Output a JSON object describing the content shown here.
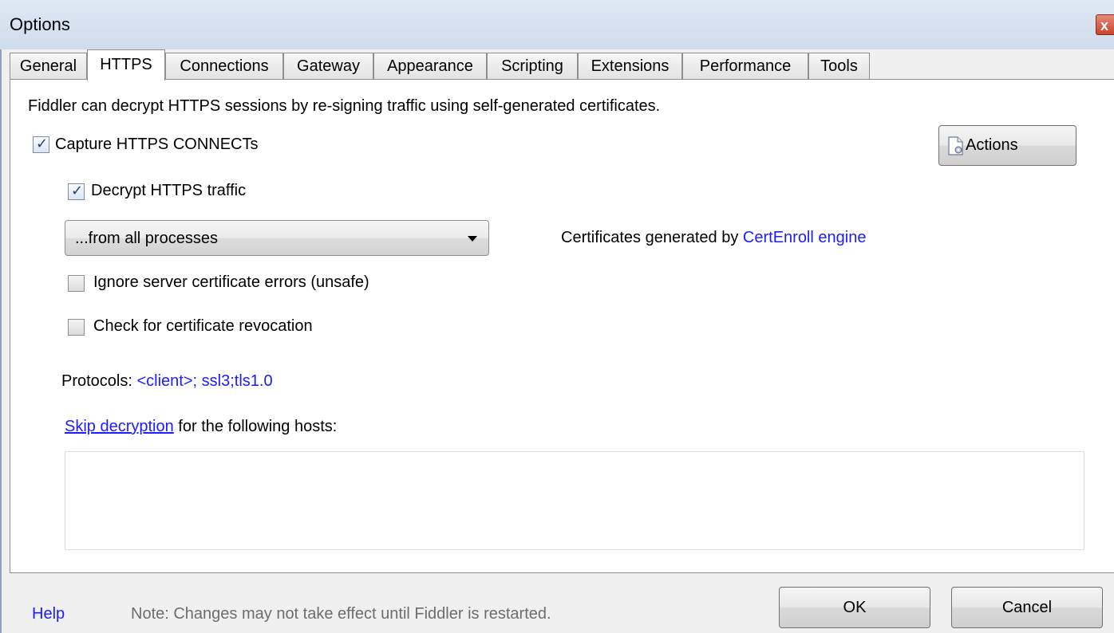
{
  "window": {
    "title": "Options",
    "close_label": "x"
  },
  "tabs": [
    {
      "label": "General",
      "active": false
    },
    {
      "label": "HTTPS",
      "active": true
    },
    {
      "label": "Connections",
      "active": false
    },
    {
      "label": "Gateway",
      "active": false
    },
    {
      "label": "Appearance",
      "active": false
    },
    {
      "label": "Scripting",
      "active": false
    },
    {
      "label": "Extensions",
      "active": false
    },
    {
      "label": "Performance",
      "active": false
    },
    {
      "label": "Tools",
      "active": false
    }
  ],
  "https": {
    "description": "Fiddler can decrypt HTTPS sessions by re-signing traffic using self-generated certificates.",
    "capture_connects": {
      "label": "Capture HTTPS CONNECTs",
      "checked": true
    },
    "actions_label": "Actions",
    "decrypt_traffic": {
      "label": "Decrypt HTTPS traffic",
      "checked": true
    },
    "process_filter": {
      "selected": "...from all processes"
    },
    "cert_info_prefix": "Certificates generated by ",
    "cert_engine_link": "CertEnroll engine",
    "ignore_errors": {
      "label": "Ignore server certificate errors (unsafe)",
      "checked": false
    },
    "check_revocation": {
      "label": "Check for certificate revocation",
      "checked": false
    },
    "protocols_label": "Protocols: ",
    "protocols_value": "<client>; ssl3;tls1.0",
    "skip_link": "Skip decryption",
    "skip_suffix": " for the following hosts:",
    "hosts_value": ""
  },
  "footer": {
    "help_link": "Help",
    "note": "Note: Changes may not take effect until Fiddler is restarted.",
    "ok_label": "OK",
    "cancel_label": "Cancel"
  },
  "colors": {
    "link": "#1c1cff",
    "titlebar": "#dfe8f4",
    "close": "#c9442c"
  }
}
